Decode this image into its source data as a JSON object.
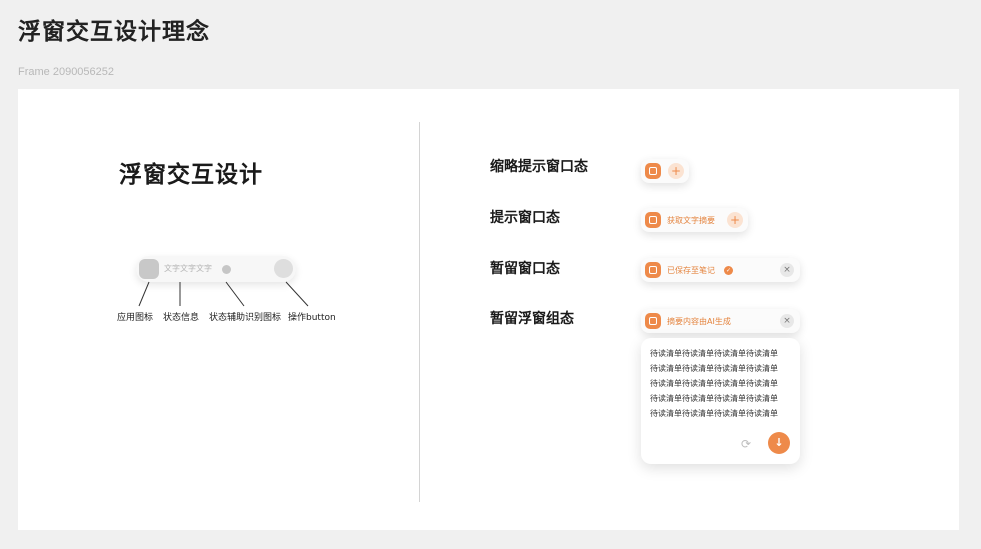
{
  "page": {
    "title": "浮窗交互设计理念",
    "frame_label": "Frame 2090056252"
  },
  "left": {
    "title": "浮窗交互设计",
    "mini_bar_text": "文字文字文字",
    "callouts": [
      "应用图标",
      "状态信息",
      "状态辅助识别图标",
      "操作button"
    ]
  },
  "right": {
    "states": [
      "缩略提示窗口态",
      "提示窗口态",
      "暂留窗口态",
      "暂留浮窗组态"
    ],
    "prompt_text": "获取文字摘要",
    "saved_text": "已保存至笔记",
    "ai_text": "摘要内容由AI生成",
    "plus_symbol": "+",
    "close_symbol": "×",
    "check_symbol": "✓",
    "panel_lines": [
      "待读清单待读清单待读清单待读清单",
      "待读清单待读清单待读清单待读清单",
      "待读清单待读清单待读清单待读清单",
      "待读清单待读清单待读清单待读清单",
      "待读清单待读清单待读清单待读清单"
    ],
    "refresh_symbol": "⟳",
    "download_symbol": "↓"
  },
  "colors": {
    "accent": "#ee8a4a",
    "accent_light": "#fbe3d2",
    "background": "#f0f0f0",
    "canvas": "#ffffff"
  },
  "icons": [
    "app-icon",
    "plus-icon",
    "close-icon",
    "check-icon",
    "refresh-icon",
    "download-icon"
  ]
}
